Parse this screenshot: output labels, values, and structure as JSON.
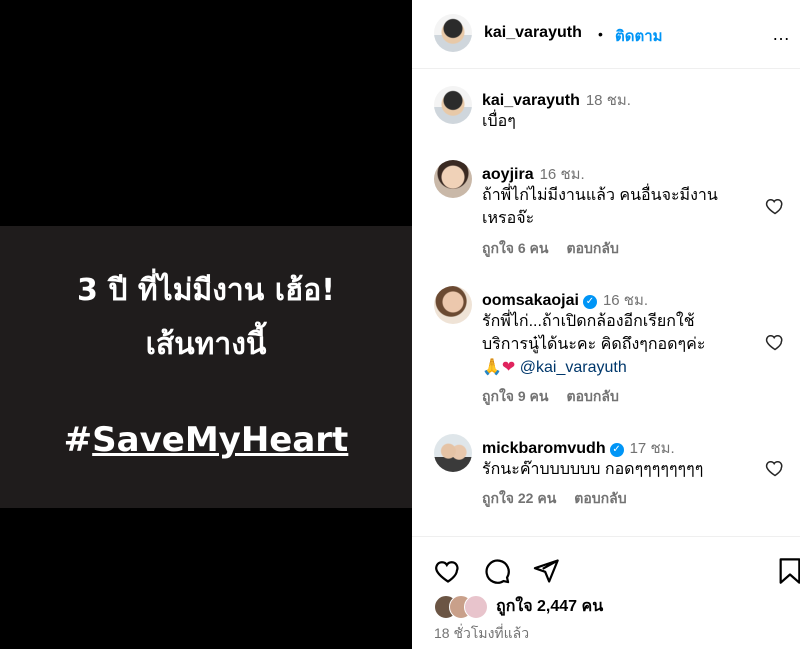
{
  "media": {
    "line1": "3 ปี ที่ไม่มีงาน เฮ้อ!",
    "line2": "เส้นทางนี้",
    "hashtag_prefix": "#",
    "hashtag_body": "SaveMyHeart"
  },
  "header": {
    "username": "kai_varayuth",
    "separator": "•",
    "follow_label": "ติดตาม",
    "more_label": "…"
  },
  "caption": {
    "username": "kai_varayuth",
    "time": "18 ชม.",
    "text": "เบื่อๆ"
  },
  "comments": [
    {
      "username": "aoyjira",
      "time": "16 ชม.",
      "text_line1": "ถ้าพี่ไก่ไม่มีงานแล้ว คนอื่นจะมีงาน",
      "text_line2": "เหรอจ๊ะ",
      "likes": "ถูกใจ 6 คน",
      "reply": "ตอบกลับ"
    },
    {
      "username": "oomsakaojai",
      "verified": true,
      "time": "16 ชม.",
      "text_line1": "รักพี่ไก่...ถ้าเปิดกล้องอีกเรียกใช้",
      "text_line2": "บริการนู๋ได้นะคะ คิดถึงๆกอดๆค่ะ",
      "emoji_pray": "🙏",
      "emoji_heart": "❤",
      "mention": "@kai_varayuth",
      "likes": "ถูกใจ 9 คน",
      "reply": "ตอบกลับ"
    },
    {
      "username": "mickbaromvudh",
      "verified": true,
      "time": "17 ชม.",
      "text_line1": "รักนะค๊าบบบบบบ กอดๆๆๆๆๆๆๆๆ",
      "likes": "ถูกใจ 22 คน",
      "reply": "ตอบกลับ"
    }
  ],
  "footer": {
    "likes_label": "ถูกใจ 2,447 คน",
    "time_ago": "18 ชั่วโมงที่แล้ว"
  },
  "icons": [
    "heart-icon",
    "comment-icon",
    "share-icon",
    "bookmark-icon"
  ]
}
